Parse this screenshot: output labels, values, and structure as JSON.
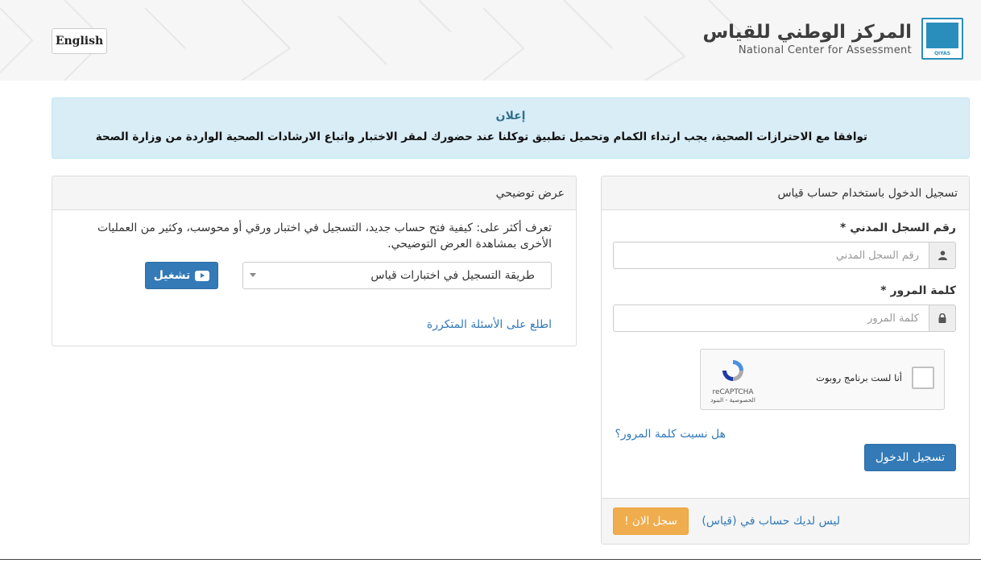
{
  "header": {
    "lang_button": "English",
    "logo_ar": "المركز الوطني للقياس",
    "logo_en": "National Center for Assessment",
    "logo_caption": "QIYAS"
  },
  "announcement": {
    "title": "إعلان",
    "text": "توافقا مع الاحترازات الصحية، يجب ارتداء الكمام وتحميل تطبيق توكلنا عند حضورك لمقر الاختبار واتباع الارشادات الصحية الواردة من وزارة الصحة"
  },
  "login": {
    "heading": "تسجيل الدخول باستخدام حساب قياس",
    "id_label": "رقم السجل المدني *",
    "id_placeholder": "رقم السجل المدني",
    "password_label": "كلمة المرور *",
    "password_placeholder": "كلمة المرور",
    "recaptcha_label": "أنا لست برنامج روبوت",
    "recaptcha_brand": "reCAPTCHA",
    "recaptcha_links": "الخصوصية - البنود",
    "forgot_link": "هل نسيت كلمة المرور؟",
    "submit": "تسجيل الدخول",
    "no_account": "ليس لديك حساب في (قياس)",
    "register": "سجل الان !"
  },
  "demo": {
    "heading": "عرض توضيحي",
    "description": "تعرف أكثر على: كيفية فتح حساب جديد، التسجيل في اختبار ورقي أو محوسب، وكثير من العمليات الأخرى بمشاهدة العرض التوضيحي.",
    "select_value": "طريقة التسجيل في اختبارات قياس",
    "play_button": "تشغيل",
    "faq_link": "اطلع على الأسئلة المتكررة"
  },
  "colors": {
    "primary": "#337ab7",
    "warning": "#f0ad4e",
    "info_bg": "#d9edf7",
    "info_title": "#31708f"
  }
}
